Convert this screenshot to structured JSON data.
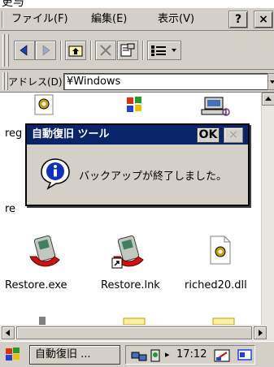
{
  "window": {
    "title_fragment": "更与"
  },
  "menu": {
    "file": "ファイル(F)",
    "edit": "編集(E)",
    "view": "表示(V)",
    "help_button": "?",
    "close_button": "×"
  },
  "toolbar": {
    "buttons": [
      "back-icon",
      "forward-icon",
      "up-folder-icon",
      "delete-icon",
      "properties-icon",
      "views-icon"
    ]
  },
  "address": {
    "label": "アドレス(D)",
    "value": "¥Windows"
  },
  "files": [
    {
      "name": "reg"
    },
    {
      "name": ""
    },
    {
      "name": ""
    },
    {
      "name": "re"
    },
    {
      "name": "Restore.exe"
    },
    {
      "name": "Restore.lnk"
    },
    {
      "name": "riched20.dll"
    }
  ],
  "dialog": {
    "title": "自動復旧 ツール",
    "ok_label": "OK",
    "close_label": "×",
    "message": "バックアップが終了しました。"
  },
  "taskbar": {
    "app_label": "自動復旧 ...",
    "clock": "17:12"
  },
  "colors": {
    "face": "#d4d0c8",
    "title_bar": "#0a246a",
    "selection": "#0a246a"
  }
}
